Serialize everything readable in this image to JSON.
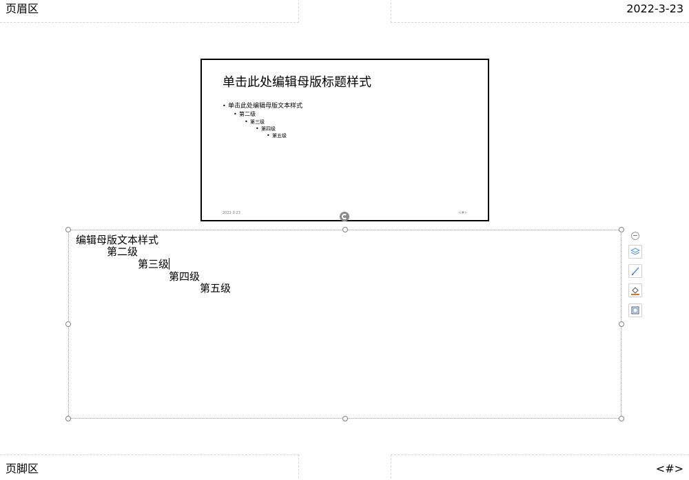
{
  "header": {
    "left_text": "页眉区",
    "right_text": "2022-3-23"
  },
  "footer": {
    "left_text": "页脚区",
    "right_text": "<#>"
  },
  "slide_thumbnail": {
    "title": "单击此处编辑母版标题样式",
    "bullets": [
      "单击此处编辑母版文本样式",
      "第二级",
      "第三级",
      "第四级",
      "第五级"
    ],
    "date": "2022-3-23",
    "number": "<#>"
  },
  "notes": {
    "lines": [
      "编辑母版文本样式",
      "第二级",
      "第三级",
      "第四级",
      "第五级"
    ]
  },
  "toolbar": {
    "icons": [
      "collapse-icon",
      "layers-icon",
      "pen-icon",
      "fill-icon",
      "border-icon"
    ],
    "accent_color": "#4a90d9",
    "fill_color": "#e07020"
  }
}
